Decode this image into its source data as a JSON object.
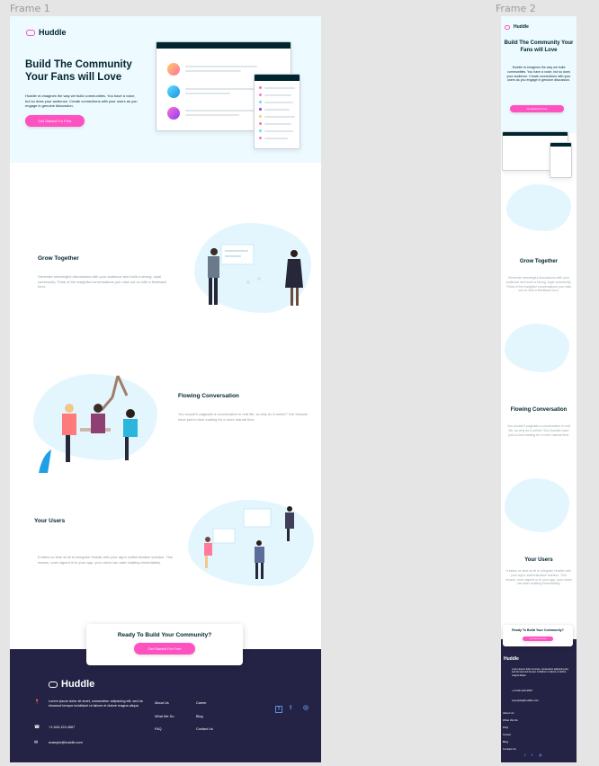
{
  "frames": [
    {
      "label": "Frame 1"
    },
    {
      "label": "Frame 2"
    }
  ],
  "brand": {
    "name": "Huddle",
    "accent": "#ff52c1",
    "dark": "#00252e",
    "footer_bg": "#242345",
    "hero_bg": "#edfaff"
  },
  "hero": {
    "title": "Build The Community Your Fans will Love",
    "title_mobile": "Build The Community Your Fans will Love",
    "description": "Huddle re-imagines the way we build communities. You have a voice, but so does your audience. Create connections with your users as you engage in genuine discussion.",
    "cta_label": "Get Started For Free"
  },
  "features": [
    {
      "title": "Grow Together",
      "text": "Generate meaningful discussions with your audience and build a strong, loyal community. Think of the insightful conversations you miss out on with a feedback form."
    },
    {
      "title": "Flowing Conversation",
      "text": "You wouldn't paginate a conversation in real life, so why do it online? Our threads have just-in-time loading for a more natural flow."
    },
    {
      "title": "Your Users",
      "text": "It takes no time at all to integrate Huddle with your app's authentication solution. This means, once signed in to your app, your users can start chatting immediately."
    }
  ],
  "cta": {
    "title": "Ready To Build Your Community?",
    "button_label": "Get Started For Free"
  },
  "footer": {
    "logo": "Huddle",
    "address": "Lorem ipsum dolor sit amet, consectetur adipiscing elit, sed do eiusmod tempor incididunt ut labore et dolore magna aliqua",
    "phone": "+1-543-123-4567",
    "email": "example@huddle.com",
    "links_col1": [
      "About Us",
      "What We Do",
      "FAQ"
    ],
    "links_col2": [
      "Career",
      "Blog",
      "Contact Us"
    ],
    "links_mobile": [
      "About Us",
      "What We Do",
      "FAQ",
      "Career",
      "Blog",
      "Contact Us"
    ],
    "social": [
      {
        "icon": "facebook-icon",
        "glyph": "f"
      },
      {
        "icon": "twitter-icon",
        "glyph": "t"
      },
      {
        "icon": "instagram-icon",
        "glyph": "◎"
      }
    ]
  },
  "icons": {
    "location": "📍",
    "phone": "☎",
    "email": "✉"
  }
}
